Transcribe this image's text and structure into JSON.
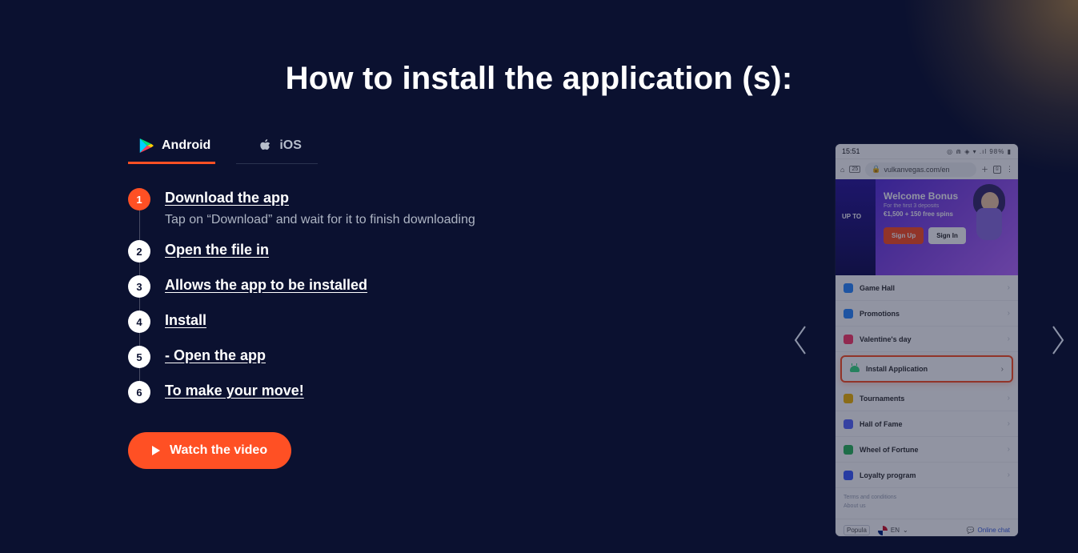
{
  "title": "How to install the application (s):",
  "tabs": {
    "android": "Android",
    "ios": "iOS"
  },
  "steps": [
    {
      "n": "1",
      "label": "Download the app",
      "sub": "Tap on “Download” and wait for it to finish downloading",
      "active": true
    },
    {
      "n": "2",
      "label": "Open the file in"
    },
    {
      "n": "3",
      "label": "Allows the app to be installed"
    },
    {
      "n": "4",
      "label": "Install"
    },
    {
      "n": "5",
      "label": "- Open the app"
    },
    {
      "n": "6",
      "label": "To make your move!"
    }
  ],
  "watch_label": "Watch the video",
  "phone": {
    "time": "15:51",
    "status_right": "◎ ⋒ ◈ ▾ .ıl 98% ▮",
    "url": "vulkanvegas.com/en",
    "addr_badge": "25",
    "hero": {
      "title": "Welcome Bonus",
      "sub": "For the first 3 deposits",
      "bonus": "€1,500 + 150 free spins",
      "signup": "Sign Up",
      "signin": "Sign In",
      "leftcol": "UP TO"
    },
    "menu": [
      {
        "label": "Game Hall",
        "color": "#2e8bff"
      },
      {
        "label": "Promotions",
        "color": "#2e8bff"
      },
      {
        "label": "Valentine's day",
        "color": "#ff3d6b"
      },
      {
        "label": "Install Application",
        "install": true
      },
      {
        "label": "Tournaments",
        "color": "#f2b705"
      },
      {
        "label": "Hall of Fame",
        "color": "#5a6bff"
      },
      {
        "label": "Wheel of Fortune",
        "color": "#2eb85c"
      },
      {
        "label": "Loyalty program",
        "color": "#3e5eff"
      }
    ],
    "footer": {
      "l1": "Terms and conditions",
      "l2": "About us"
    },
    "bottom": {
      "lang": "EN",
      "chat": "Online chat",
      "left_label": "Popula"
    }
  }
}
